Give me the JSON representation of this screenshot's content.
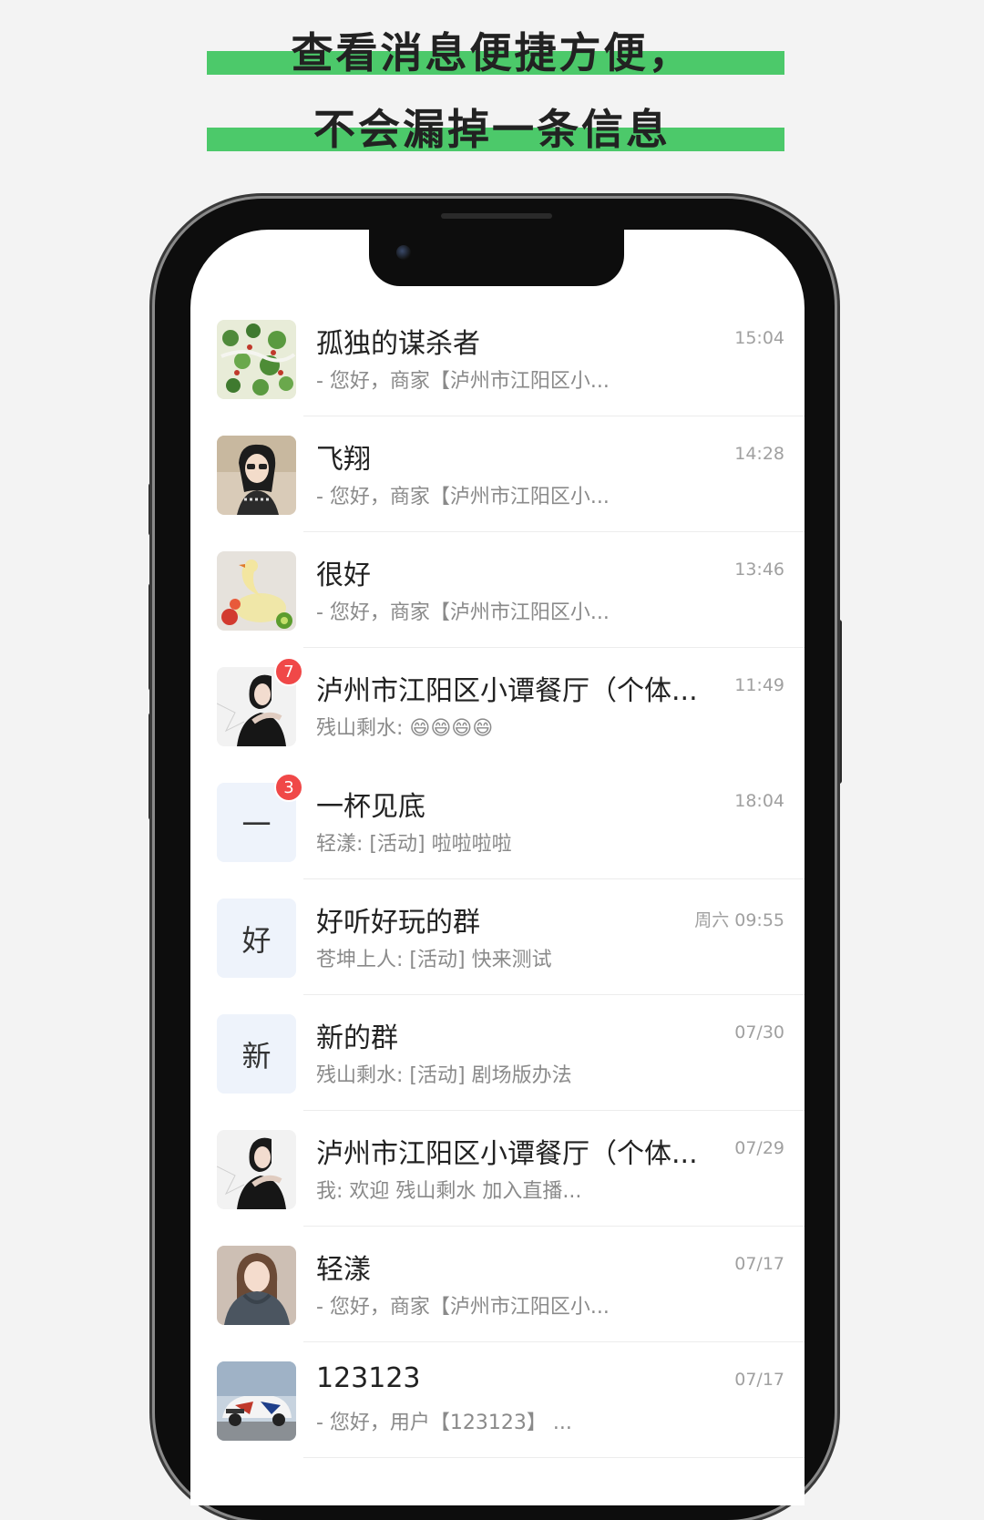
{
  "headline": {
    "line1": "查看消息便捷方便，",
    "line2": "不会漏掉一条信息"
  },
  "chats": [
    {
      "name": "孤独的谋杀者",
      "time": "15:04",
      "preview": "- 您好，商家【泸州市江阳区小...",
      "avatar": "map-pattern",
      "badge": ""
    },
    {
      "name": "飞翔",
      "time": "14:28",
      "preview": "- 您好，商家【泸州市江阳区小...",
      "avatar": "girl-sunglasses",
      "badge": ""
    },
    {
      "name": "很好",
      "time": "13:46",
      "preview": "- 您好，商家【泸州市江阳区小...",
      "avatar": "fruit-swan",
      "badge": ""
    },
    {
      "name": "泸州市江阳区小谭餐厅（个体...",
      "time": "11:49",
      "preview": "残山剩水: 😄😄😄😄",
      "avatar": "woman-black",
      "badge": "7"
    },
    {
      "name": "一杯见底",
      "time": "18:04",
      "preview": "轻漾: [活动] 啦啦啦啦",
      "avatar_text": "一",
      "badge": "3"
    },
    {
      "name": "好听好玩的群",
      "time": "周六 09:55",
      "preview": "苍坤上人: [活动] 快来测试",
      "avatar_text": "好",
      "badge": ""
    },
    {
      "name": "新的群",
      "time": "07/30",
      "preview": "残山剩水: [活动] 剧场版办法",
      "avatar_text": "新",
      "badge": ""
    },
    {
      "name": "泸州市江阳区小谭餐厅（个体...",
      "time": "07/29",
      "preview": "我: 欢迎 残山剩水 加入直播...",
      "avatar": "woman-black",
      "badge": ""
    },
    {
      "name": "轻漾",
      "time": "07/17",
      "preview": "- 您好，商家【泸州市江阳区小...",
      "avatar": "woman-hoodie",
      "badge": ""
    },
    {
      "name": "123123",
      "time": "07/17",
      "preview": "- 您好，用户【123123】 ...",
      "avatar": "race-car",
      "badge": ""
    }
  ]
}
